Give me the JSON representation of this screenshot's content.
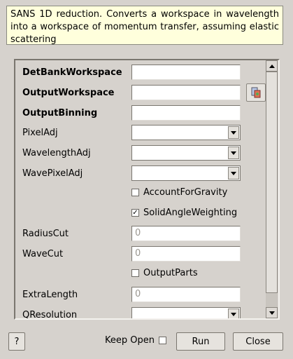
{
  "description": "SANS 1D reduction. Converts a workspace in wavelength into a workspace of momentum transfer, assuming elastic scattering",
  "fields": [
    {
      "label": "DetBankWorkspace",
      "type": "text",
      "value": "",
      "required": true
    },
    {
      "label": "OutputWorkspace",
      "type": "text",
      "value": "",
      "required": true,
      "browse": true
    },
    {
      "label": "OutputBinning",
      "type": "text",
      "value": "",
      "required": true
    },
    {
      "label": "PixelAdj",
      "type": "combo",
      "value": ""
    },
    {
      "label": "WavelengthAdj",
      "type": "combo",
      "value": ""
    },
    {
      "label": "WavePixelAdj",
      "type": "combo",
      "value": ""
    },
    {
      "label": "AccountForGravity",
      "type": "check",
      "checked": false
    },
    {
      "label": "SolidAngleWeighting",
      "type": "check",
      "checked": true
    },
    {
      "label": "RadiusCut",
      "type": "text",
      "value": "0"
    },
    {
      "label": "WaveCut",
      "type": "text",
      "value": "0"
    },
    {
      "label": "OutputParts",
      "type": "check",
      "checked": false
    },
    {
      "label": "ExtraLength",
      "type": "text",
      "value": "0"
    },
    {
      "label": "QResolution",
      "type": "combo",
      "value": ""
    }
  ],
  "footer": {
    "help_label": "?",
    "keep_open_label": "Keep Open",
    "keep_open_checked": false,
    "run_label": "Run",
    "close_label": "Close"
  },
  "icons": {
    "browse": "folder-browse-icon",
    "check": "✓"
  }
}
